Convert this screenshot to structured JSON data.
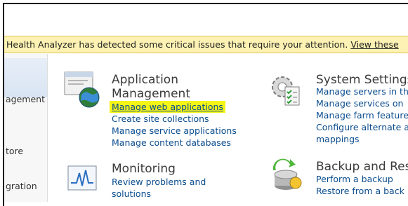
{
  "alert": {
    "text": "Health Analyzer has detected some critical issues that require your attention.",
    "link": "View these"
  },
  "leftnav": {
    "items": [
      "agement",
      "tore",
      "gration"
    ]
  },
  "app_management": {
    "title_line1": "Application",
    "title_line2": "Management",
    "links": [
      "Manage web applications",
      "Create site collections",
      "Manage service applications",
      "Manage content databases"
    ]
  },
  "monitoring": {
    "title": "Monitoring",
    "links": [
      "Review problems and",
      "solutions"
    ]
  },
  "system_settings": {
    "title": "System Settings",
    "links": [
      "Manage servers in th",
      "Manage services on",
      "Manage farm feature",
      "Configure alternate a",
      "mappings"
    ]
  },
  "backup": {
    "title": "Backup and Res",
    "links": [
      "Perform a backup",
      "Restore from a back"
    ]
  },
  "icons": {
    "app_management": "web-application-globe-icon",
    "monitoring": "monitoring-chart-icon",
    "system_settings": "gear-checklist-icon",
    "backup": "backup-drive-icon"
  }
}
